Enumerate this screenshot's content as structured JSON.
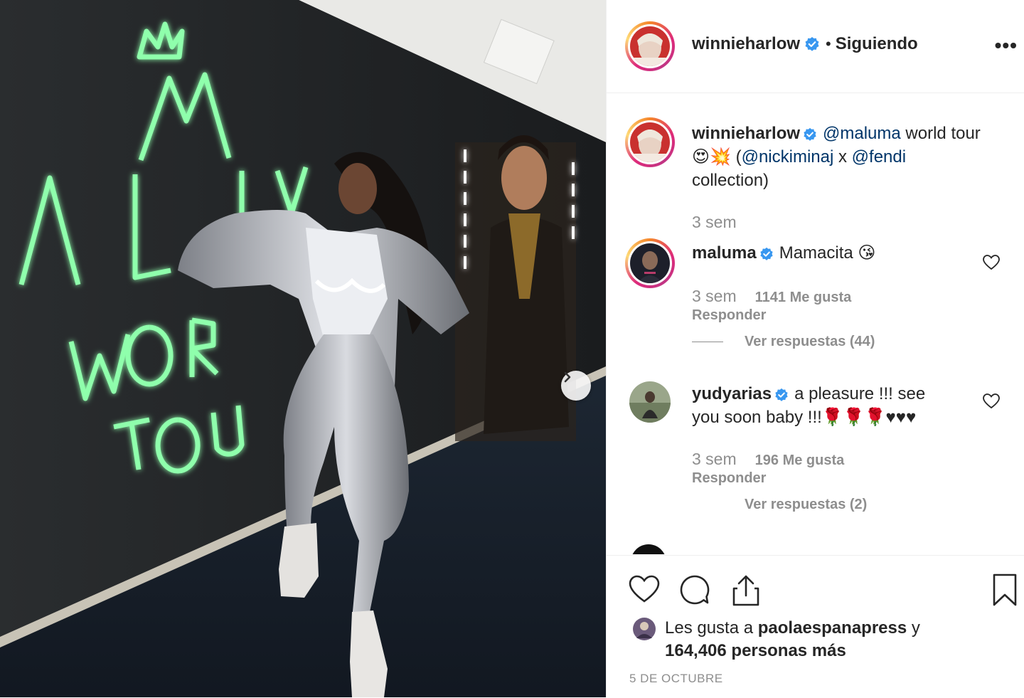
{
  "photo": {
    "wall_text": [
      "ALUM",
      "WORL",
      "TOU"
    ],
    "next_icon": "chevron-right-icon"
  },
  "header": {
    "username": "winnieharlow",
    "separator": "•",
    "follow_label": "Siguiendo",
    "more_label": "•••"
  },
  "caption": {
    "username": "winnieharlow",
    "mention1": "@maluma",
    "text1": "world tour",
    "emojis": "😍💥",
    "open": "(",
    "mention2": "@nickiminaj",
    "x": "x",
    "mention3": "@fendi",
    "text2": "collection)",
    "time": "3 sem"
  },
  "comments": [
    {
      "username": "maluma",
      "text": "Mamacita 😘",
      "time": "3 sem",
      "likes": "1141 Me gusta",
      "reply": "Responder",
      "view_replies": "Ver respuestas (44)"
    },
    {
      "username": "yudyarias",
      "text": "a pleasure !!! see you soon baby !!!🌹🌹🌹♥♥♥",
      "time": "3 sem",
      "likes": "196 Me gusta",
      "reply": "Responder",
      "view_replies": "Ver respuestas (2)"
    }
  ],
  "footer": {
    "likes_prefix": "Les gusta a",
    "likes_user": "paolaespanapress",
    "likes_and": "y",
    "likes_count": "164,406 personas más",
    "date": "5 DE OCTUBRE"
  },
  "colors": {
    "verified": "#3897f0",
    "neon": "#7dff9a",
    "link": "#003569",
    "muted": "#8e8e8e"
  }
}
